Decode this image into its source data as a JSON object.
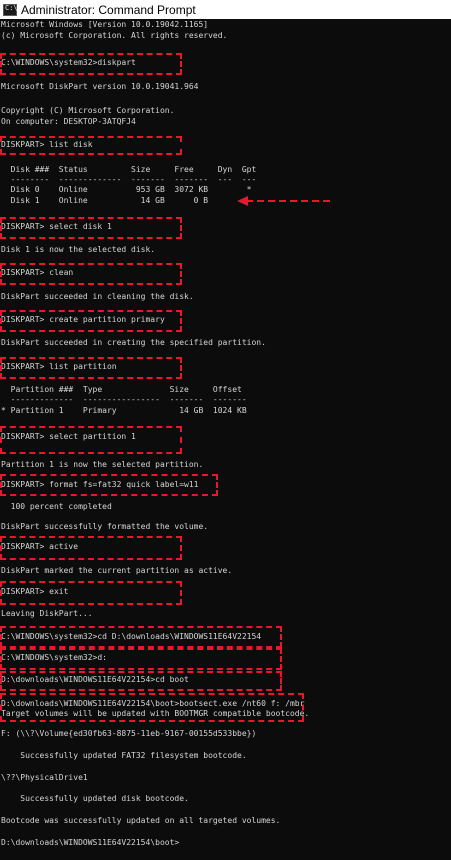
{
  "window": {
    "title": "Administrator: Command Prompt",
    "icon": "console-icon",
    "icon_glyph": "C:\\"
  },
  "console": {
    "lines": [
      {
        "id": "windows-version",
        "text": "Microsoft Windows [Version 10.0.19042.1165]"
      },
      {
        "id": "copyright-ms",
        "text": "(c) Microsoft Corporation. All rights reserved."
      },
      {
        "id": "cmd-diskpart",
        "text": "C:\\WINDOWS\\system32>diskpart"
      },
      {
        "id": "diskpart-version",
        "text": "Microsoft DiskPart version 10.0.19041.964"
      },
      {
        "id": "diskpart-copyright",
        "text": "Copyright (C) Microsoft Corporation."
      },
      {
        "id": "computer-name",
        "text": "On computer: DESKTOP-3ATQFJ4"
      },
      {
        "id": "cmd-list-disk",
        "text": "DISKPART> list disk"
      },
      {
        "id": "disk-header",
        "text": "  Disk ###  Status         Size     Free     Dyn  Gpt"
      },
      {
        "id": "disk-separator",
        "text": "  --------  -------------  -------  -------  ---  ---"
      },
      {
        "id": "disk-0-row",
        "text": "  Disk 0    Online          953 GB  3072 KB        *"
      },
      {
        "id": "disk-1-row",
        "text": "  Disk 1    Online           14 GB      0 B"
      },
      {
        "id": "cmd-select-disk",
        "text": "DISKPART> select disk 1"
      },
      {
        "id": "disk-selected",
        "text": "Disk 1 is now the selected disk."
      },
      {
        "id": "cmd-clean",
        "text": "DISKPART> clean"
      },
      {
        "id": "clean-result",
        "text": "DiskPart succeeded in cleaning the disk."
      },
      {
        "id": "cmd-create-partition",
        "text": "DISKPART> create partition primary"
      },
      {
        "id": "create-result",
        "text": "DiskPart succeeded in creating the specified partition."
      },
      {
        "id": "cmd-list-partition",
        "text": "DISKPART> list partition"
      },
      {
        "id": "partition-header",
        "text": "  Partition ###  Type              Size     Offset"
      },
      {
        "id": "partition-separator",
        "text": "  -------------  ----------------  -------  -------"
      },
      {
        "id": "partition-1-row",
        "text": "* Partition 1    Primary             14 GB  1024 KB"
      },
      {
        "id": "cmd-select-partition",
        "text": "DISKPART> select partition 1"
      },
      {
        "id": "partition-selected",
        "text": "Partition 1 is now the selected partition."
      },
      {
        "id": "cmd-format",
        "text": "DISKPART> format fs=fat32 quick label=w11"
      },
      {
        "id": "format-progress",
        "text": "  100 percent completed"
      },
      {
        "id": "format-result",
        "text": "DiskPart successfully formatted the volume."
      },
      {
        "id": "cmd-active",
        "text": "DISKPART> active"
      },
      {
        "id": "active-result",
        "text": "DiskPart marked the current partition as active."
      },
      {
        "id": "cmd-exit",
        "text": "DISKPART> exit"
      },
      {
        "id": "leaving-diskpart",
        "text": "Leaving DiskPart..."
      },
      {
        "id": "cmd-cd-downloads",
        "text": "C:\\WINDOWS\\system32>cd D:\\downloads\\WINDOWS11E64V22154"
      },
      {
        "id": "cmd-drive-d",
        "text": "C:\\WINDOWS\\system32>d:"
      },
      {
        "id": "cmd-cd-boot",
        "text": "D:\\downloads\\WINDOWS11E64V22154>cd boot"
      },
      {
        "id": "cmd-bootsect",
        "text": "D:\\downloads\\WINDOWS11E64V22154\\boot>bootsect.exe /nt60 f: /mbr"
      },
      {
        "id": "target-volumes",
        "text": "Target volumes will be updated with BOOTMGR compatible bootcode."
      },
      {
        "id": "volume-guid",
        "text": "F: (\\\\?\\Volume{ed30fb63-8875-11eb-9167-00155d533bbe})"
      },
      {
        "id": "fat32-updated",
        "text": "    Successfully updated FAT32 filesystem bootcode."
      },
      {
        "id": "physical-drive",
        "text": "\\??\\PhysicalDrive1"
      },
      {
        "id": "disk-bootcode-updated",
        "text": "    Successfully updated disk bootcode."
      },
      {
        "id": "bootcode-all-updated",
        "text": "Bootcode was successfully updated on all targeted volumes."
      },
      {
        "id": "final-prompt",
        "text": "D:\\downloads\\WINDOWS11E64V22154\\boot>"
      }
    ]
  },
  "annotations": {
    "highlight_color": "#e8172c",
    "text_color": "#d6d6d6",
    "background_color": "#0c0c0c"
  }
}
